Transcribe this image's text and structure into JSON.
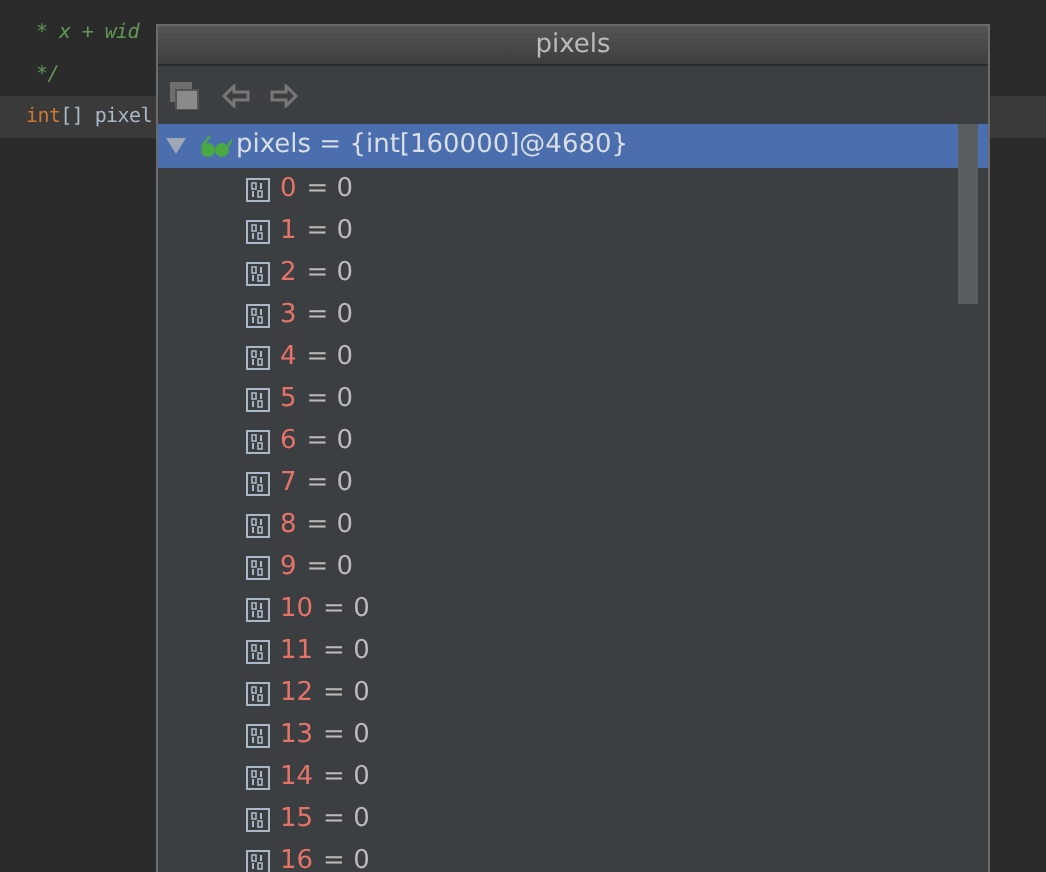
{
  "editor": {
    "lines": [
      {
        "kind": "comment",
        "text": "*  x + wid",
        "current": false
      },
      {
        "kind": "comment",
        "text": "*/",
        "current": false
      },
      {
        "kind": "code",
        "keyword": "int",
        "text": "[] pixel",
        "current": true
      }
    ]
  },
  "popup": {
    "title": "pixels",
    "tree": {
      "label": "pixels = {int[160000]@4680}",
      "expanded": true,
      "selected": true,
      "children": [
        {
          "name": "0",
          "value": "= 0"
        },
        {
          "name": "1",
          "value": "= 0"
        },
        {
          "name": "2",
          "value": "= 0"
        },
        {
          "name": "3",
          "value": "= 0"
        },
        {
          "name": "4",
          "value": "= 0"
        },
        {
          "name": "5",
          "value": "= 0"
        },
        {
          "name": "6",
          "value": "= 0"
        },
        {
          "name": "7",
          "value": "= 0"
        },
        {
          "name": "8",
          "value": "= 0"
        },
        {
          "name": "9",
          "value": "= 0"
        },
        {
          "name": "10",
          "value": "= 0"
        },
        {
          "name": "11",
          "value": "= 0"
        },
        {
          "name": "12",
          "value": "= 0"
        },
        {
          "name": "13",
          "value": "= 0"
        },
        {
          "name": "14",
          "value": "= 0"
        },
        {
          "name": "15",
          "value": "= 0"
        },
        {
          "name": "16",
          "value": "= 0"
        }
      ]
    }
  }
}
